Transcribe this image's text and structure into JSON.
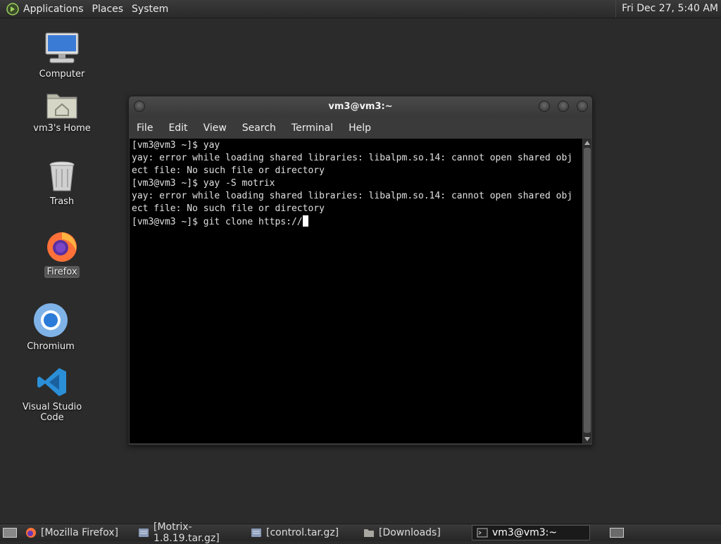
{
  "top_panel": {
    "menus": [
      "Applications",
      "Places",
      "System"
    ],
    "clock": "Fri Dec 27,  5:40 AM"
  },
  "desktop_icons": {
    "computer": "Computer",
    "home": "vm3's Home",
    "trash": "Trash",
    "firefox": "Firefox",
    "chromium": "Chromium",
    "vscode": "Visual Studio Code"
  },
  "terminal": {
    "title": "vm3@vm3:~",
    "menu": [
      "File",
      "Edit",
      "View",
      "Search",
      "Terminal",
      "Help"
    ],
    "lines": [
      "[vm3@vm3 ~]$ yay",
      "yay: error while loading shared libraries: libalpm.so.14: cannot open shared obj",
      "ect file: No such file or directory",
      "[vm3@vm3 ~]$ yay -S motrix",
      "yay: error while loading shared libraries: libalpm.so.14: cannot open shared obj",
      "ect file: No such file or directory",
      "[vm3@vm3 ~]$ git clone https://"
    ]
  },
  "taskbar": {
    "tasks": [
      "[Mozilla Firefox]",
      "[Motrix-1.8.19.tar.gz]",
      "[control.tar.gz]",
      "[Downloads]",
      "vm3@vm3:~"
    ]
  },
  "colors": {
    "panel": "#2e2e2e",
    "desktop": "#2b2b2b",
    "terminal_bg": "#000000"
  }
}
